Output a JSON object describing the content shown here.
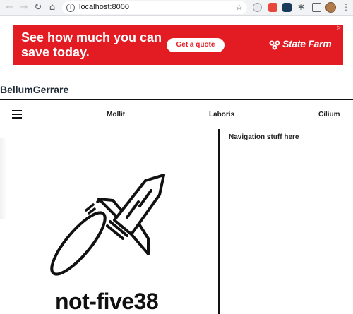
{
  "browser": {
    "url": "localhost:8000",
    "icons": [
      "back-icon",
      "forward-icon",
      "reload-icon",
      "home-icon",
      "info-icon",
      "star-icon",
      "extensions-icon",
      "cast-icon",
      "menu-icon"
    ]
  },
  "ad": {
    "headline": "See how much you can save today.",
    "cta_label": "Get a quote",
    "brand_label": "State Farm",
    "background": "#e31c23"
  },
  "header": {
    "brand": "BellumGerrare"
  },
  "nav": {
    "links": [
      "Mollit",
      "Laboris",
      "Cilium"
    ]
  },
  "sidebar": {
    "title": "Navigation stuff here"
  },
  "main": {
    "image_icon": "rocket-icon",
    "caption": "not-five38"
  }
}
